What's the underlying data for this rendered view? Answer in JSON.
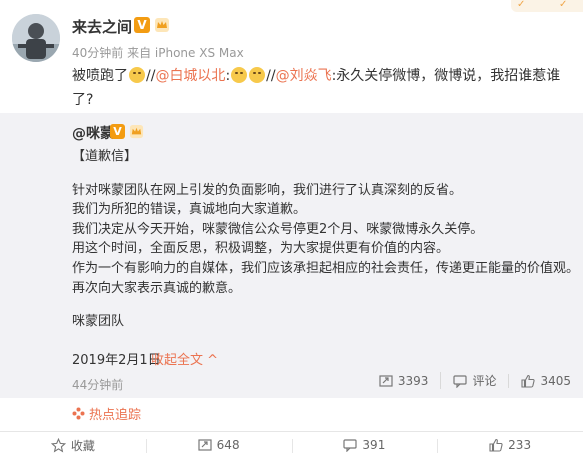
{
  "post": {
    "username": "来去之间",
    "verified_badge": "V",
    "meta": "40分钟前 来自 iPhone XS Max",
    "text_before": "被喷跑了",
    "text_slash_1": "//",
    "mention_1": "@白城以北",
    "mention_1_suffix": ":",
    "text_slash_2": "//",
    "mention_2": "@刘焱飞",
    "text_after": ":永久关停微博，微博说，我招谁惹谁了?"
  },
  "repost": {
    "username": "@咪蒙",
    "verified_badge": "V",
    "lines": [
      "【道歉信】",
      "",
      "针对咪蒙团队在网上引发的负面影响，我们进行了认真深刻的反省。",
      "我们为所犯的错误，真诚地向大家道歉。",
      "我们决定从今天开始，咪蒙微信公众号停更2个月、咪蒙微博永久关停。",
      "用这个时间，全面反思，积极调整，为大家提供更有价值的内容。",
      "作为一个有影响力的自媒体，我们应该承担起相应的社会责任，传递更正能量的价值观。",
      "再次向大家表示真诚的歉意。",
      "",
      "咪蒙团队"
    ],
    "date": "2019年2月1日",
    "collapse_label": "收起全文 ^",
    "time": "44分钟前",
    "repost_count": "3393",
    "comment_label": "评论",
    "like_count": "3405"
  },
  "hot_label": "热点追踪",
  "bottom": {
    "favorite_label": "收藏",
    "repost_count": "648",
    "comment_count": "391",
    "like_count": "233"
  },
  "colors": {
    "link": "#eb7350",
    "badge": "#f39c12",
    "repost_bg": "#f2f2f5"
  }
}
